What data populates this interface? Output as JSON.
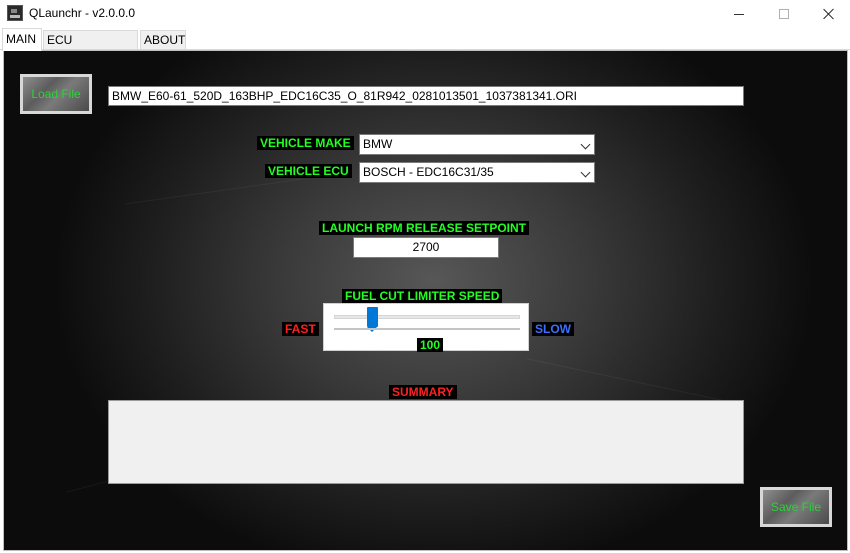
{
  "window": {
    "title": "QLaunchr - v2.0.0.0",
    "icon": "app-logo-icon"
  },
  "tabs": [
    {
      "label": "MAIN",
      "active": true
    },
    {
      "label": "ECU COVERAGE",
      "active": false
    },
    {
      "label": "ABOUT",
      "active": false
    }
  ],
  "main": {
    "load_button": "Load File",
    "file_name": "BMW_E60-61_520D_163BHP_EDC16C35_O_81R942_0281013501_1037381341.ORI",
    "vehicle_make_label": "VEHICLE MAKE",
    "vehicle_make_value": "BMW",
    "vehicle_ecu_label": "VEHICLE ECU",
    "vehicle_ecu_value": "BOSCH - EDC16C31/35",
    "rpm_label": "LAUNCH RPM RELEASE SETPOINT",
    "rpm_value": "2700",
    "fuel_cut_label": "FUEL CUT LIMITER SPEED",
    "fast_label": "FAST",
    "slow_label": "SLOW",
    "fuel_cut_value": "100",
    "summary_label": "SUMMARY",
    "summary_text": "",
    "save_button": "Save File"
  },
  "colors": {
    "label_green": "#22ff22",
    "label_red": "#ff2020",
    "label_blue": "#3d6fff",
    "slider_accent": "#0078d7"
  }
}
